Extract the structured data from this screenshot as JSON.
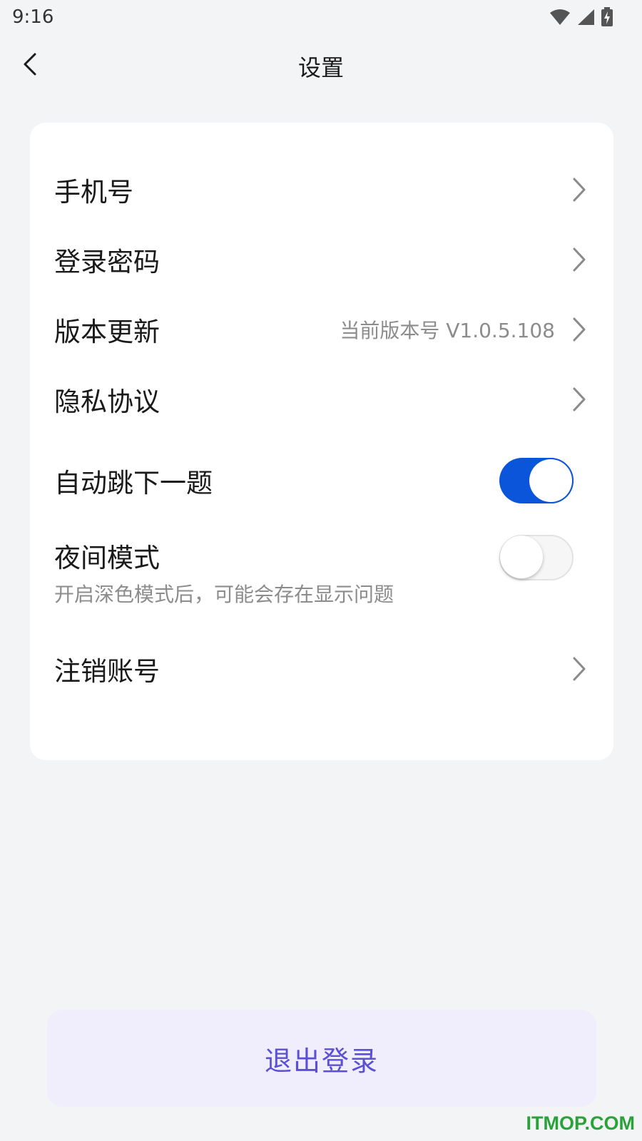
{
  "status_bar": {
    "time": "9:16",
    "icons": [
      "wifi-icon",
      "signal-icon",
      "battery-charging-icon"
    ]
  },
  "header": {
    "back_icon": "chevron-left-icon",
    "title": "设置"
  },
  "settings": {
    "phone": {
      "label": "手机号"
    },
    "password": {
      "label": "登录密码"
    },
    "version": {
      "label": "版本更新",
      "value": "当前版本号 V1.0.5.108"
    },
    "privacy": {
      "label": "隐私协议"
    },
    "auto_next": {
      "label": "自动跳下一题",
      "enabled": true
    },
    "night_mode": {
      "label": "夜间模式",
      "subtitle": "开启深色模式后，可能会存在显示问题",
      "enabled": false
    },
    "deactivate": {
      "label": "注销账号"
    }
  },
  "logout": {
    "label": "退出登录"
  },
  "watermark": "ITMOP.COM",
  "colors": {
    "background": "#f3f4f6",
    "accent_blue": "#0a55d9",
    "logout_text": "#5b4fd6",
    "logout_bg": "#f0eefc",
    "watermark": "#2aa23a"
  }
}
